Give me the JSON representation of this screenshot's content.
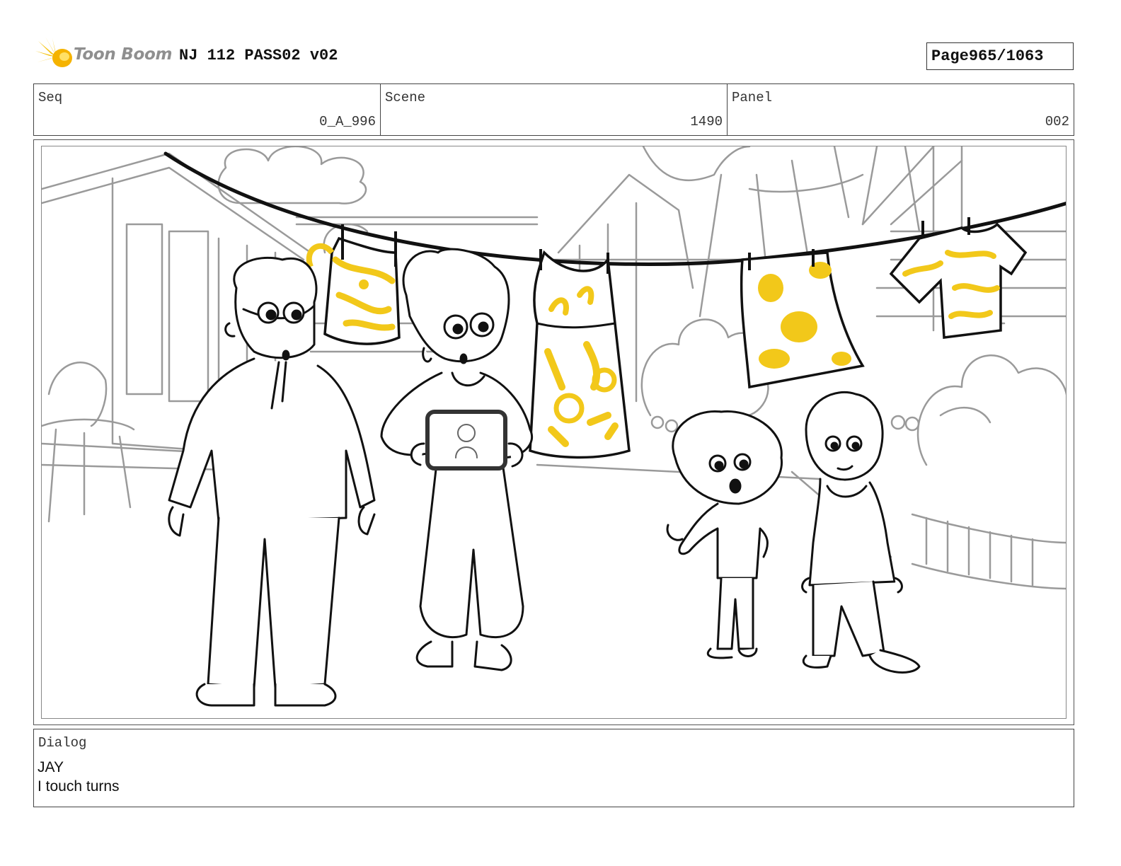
{
  "header": {
    "logo_text": "Toon Boom",
    "title": "NJ 112 PASS02 v02",
    "page_label": "Page",
    "page_value": "965/1063"
  },
  "info": {
    "seq_label": "Seq",
    "seq_value": "0_A_996",
    "scene_label": "Scene",
    "scene_value": "1490",
    "panel_label": "Panel",
    "panel_value": "002"
  },
  "dialog": {
    "label": "Dialog",
    "speaker": "JAY",
    "line": "I touch turns"
  },
  "colors": {
    "accent_yellow": "#f2c81a",
    "line_dark": "#111111",
    "line_light": "#9a9a9a"
  }
}
